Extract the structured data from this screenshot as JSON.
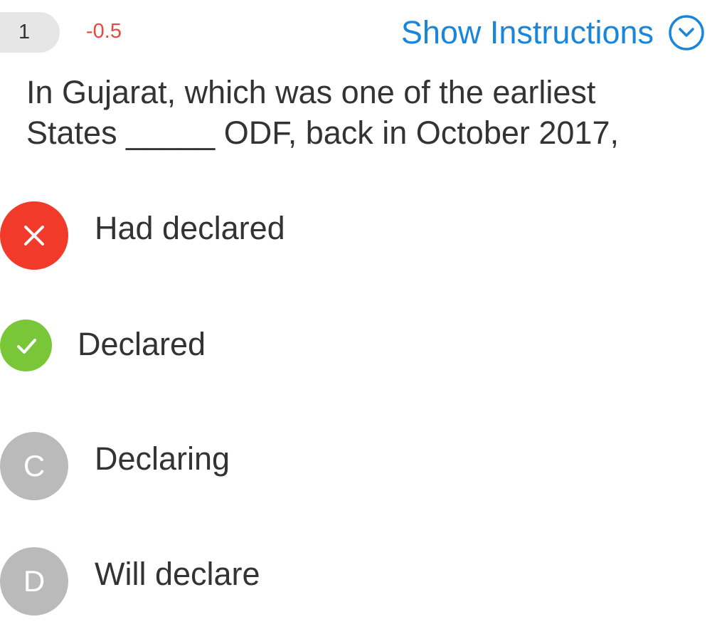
{
  "header": {
    "question_number": "1",
    "marks": "-0.5",
    "show_instructions_label": "Show Instructions"
  },
  "question": {
    "text": "In Gujarat, which was one of the earliest States _____ ODF, back in October 2017,"
  },
  "options": [
    {
      "badge": "",
      "state": "wrong",
      "label": "Had declared"
    },
    {
      "badge": "",
      "state": "correct",
      "label": "Declared"
    },
    {
      "badge": "C",
      "state": "unselected",
      "label": "Declaring"
    },
    {
      "badge": "D",
      "state": "unselected",
      "label": "Will declare"
    }
  ],
  "colors": {
    "accent": "#1a86db",
    "negative_marks": "#e64a3e",
    "wrong": "#f23a2a",
    "correct": "#7ac639",
    "neutral": "#bababa"
  },
  "icons": {
    "wrong": "close-icon",
    "correct": "check-icon",
    "instructions": "chevron-down-circle-icon"
  }
}
